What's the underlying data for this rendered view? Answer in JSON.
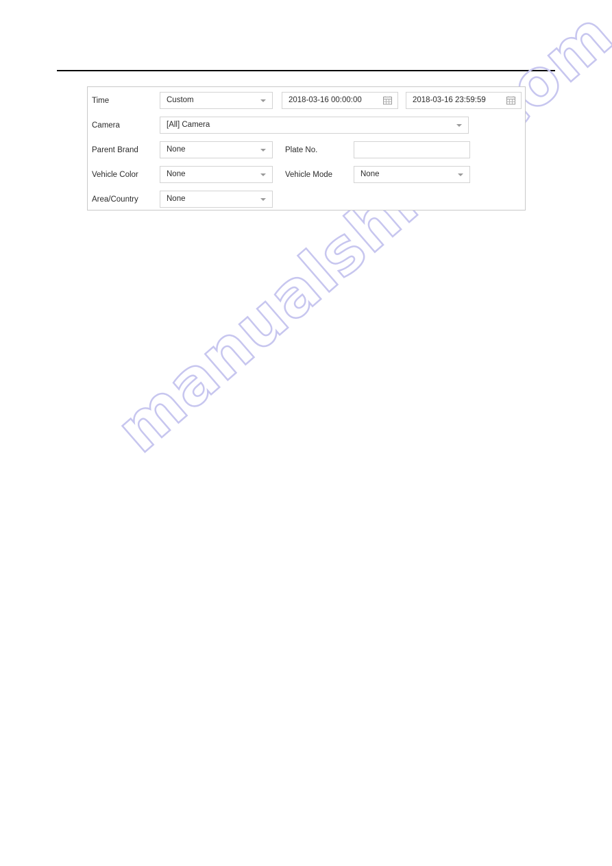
{
  "page": {
    "background": "#ffffff",
    "rule_color": "#000000"
  },
  "watermark": {
    "text": "manualshive.com",
    "color": "#c7c6ef"
  },
  "filter_panel": {
    "border_color": "#c9c9c9",
    "field_border_color": "#d3d3d3",
    "rows": [
      {
        "label": "Time",
        "mode_value": "Custom",
        "start_datetime": "2018-03-16 00:00:00",
        "end_datetime": "2018-03-16 23:59:59",
        "start_icon": "calendar-icon",
        "end_icon": "calendar-icon"
      },
      {
        "label": "Camera",
        "value": "[All] Camera"
      },
      {
        "label": "Parent Brand",
        "value": "None",
        "label2": "Plate No.",
        "value2": "",
        "placeholder2": ""
      },
      {
        "label": "Vehicle Color",
        "value": "None",
        "label2": "Vehicle Mode",
        "value2": "None"
      },
      {
        "label": "Area/Country",
        "value": "None"
      }
    ]
  }
}
